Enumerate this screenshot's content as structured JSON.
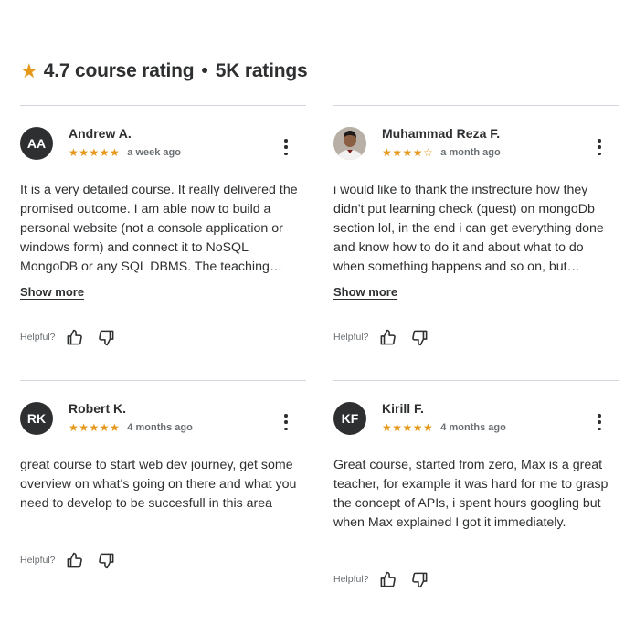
{
  "header": {
    "rating": "4.7 course rating",
    "separator": "•",
    "count": "5K ratings",
    "star_icon": "star-icon",
    "accent": "#e59819"
  },
  "reviews": [
    {
      "initials": "AA",
      "name": "Andrew A.",
      "stars": "★★★★★",
      "rating": 5,
      "ago": "a week ago",
      "body": "It is a very detailed course. It really delivered the promised outcome. I am able now to build a personal website (not a console application or windows form) and connect it to NoSQL MongoDB or any SQL DBMS. The teaching…",
      "show_more": "Show more",
      "helpful": "Helpful?"
    },
    {
      "initials": "",
      "name": "Muhammad Reza F.",
      "stars": "★★★★",
      "stars_empty": "☆",
      "rating": 4,
      "ago": "a month ago",
      "body": "i would like to thank the instrecture how they didn't put learning check (quest) on mongoDb section lol, in the end i can get everything done and know how to do it and about what to do when something happens and so on, but…",
      "show_more": "Show more",
      "helpful": "Helpful?"
    },
    {
      "initials": "RK",
      "name": "Robert K.",
      "stars": "★★★★★",
      "rating": 5,
      "ago": "4 months ago",
      "body": "great course to start web dev journey, get some overview on what's going on there and what you need to develop to be succesfull in this area",
      "helpful": "Helpful?"
    },
    {
      "initials": "KF",
      "name": "Kirill F.",
      "stars": "★★★★★",
      "rating": 5,
      "ago": "4 months ago",
      "body": "Great course, started from zero, Max is a great teacher, for example it was hard for me to grasp the concept of APIs, i spent hours googling but when Max explained I got it immediately.",
      "helpful": "Helpful?"
    }
  ]
}
